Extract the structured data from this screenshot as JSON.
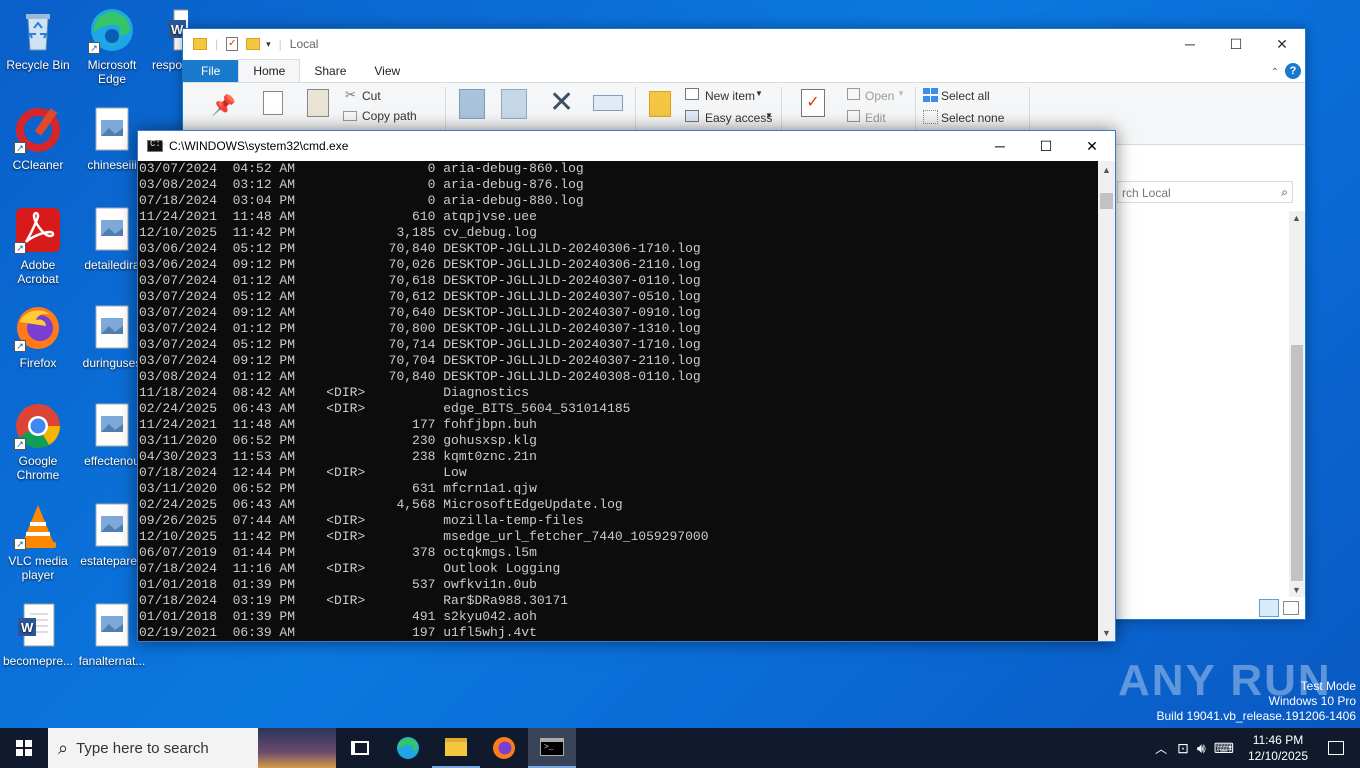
{
  "desktop_icons": [
    {
      "label": "Recycle Bin",
      "icon": "recycle-bin-icon"
    },
    {
      "label": "Microsoft Edge",
      "icon": "edge-icon"
    },
    {
      "label": "respo",
      "icon": "word-doc-icon"
    },
    {
      "label": "CCleaner",
      "icon": "ccleaner-icon"
    },
    {
      "label": "chineseiii",
      "icon": "image-file-icon"
    },
    {
      "label": "Adobe Acrobat",
      "icon": "acrobat-icon"
    },
    {
      "label": "detailedira",
      "icon": "image-file-icon"
    },
    {
      "label": "Firefox",
      "icon": "firefox-icon"
    },
    {
      "label": "duringuses",
      "icon": "image-file-icon"
    },
    {
      "label": "Google Chrome",
      "icon": "chrome-icon"
    },
    {
      "label": "effectenou",
      "icon": "image-file-icon"
    },
    {
      "label": "VLC media player",
      "icon": "vlc-icon"
    },
    {
      "label": "estateparen",
      "icon": "image-file-icon"
    },
    {
      "label": "becomepre...",
      "icon": "word-doc-icon"
    },
    {
      "label": "fanalternat...",
      "icon": "image-file-icon"
    }
  ],
  "explorer": {
    "title": "Local",
    "tabs": [
      "File",
      "Home",
      "Share",
      "View"
    ],
    "ribbon": {
      "cut": "Cut",
      "copy_path": "Copy path",
      "new_item": "New item",
      "easy_access": "Easy access",
      "open": "Open",
      "edit": "Edit",
      "select_all": "Select all",
      "select_none": "Select none"
    },
    "search_placeholder": "rch Local"
  },
  "cmd": {
    "title": "C:\\WINDOWS\\system32\\cmd.exe",
    "lines": [
      "03/07/2024  04:52 AM                 0 aria-debug-860.log",
      "03/08/2024  03:12 AM                 0 aria-debug-876.log",
      "07/18/2024  03:04 PM                 0 aria-debug-880.log",
      "11/24/2021  11:48 AM               610 atqpjvse.uee",
      "12/10/2025  11:42 PM             3,185 cv_debug.log",
      "03/06/2024  05:12 PM            70,840 DESKTOP-JGLLJLD-20240306-1710.log",
      "03/06/2024  09:12 PM            70,026 DESKTOP-JGLLJLD-20240306-2110.log",
      "03/07/2024  01:12 AM            70,618 DESKTOP-JGLLJLD-20240307-0110.log",
      "03/07/2024  05:12 AM            70,612 DESKTOP-JGLLJLD-20240307-0510.log",
      "03/07/2024  09:12 AM            70,640 DESKTOP-JGLLJLD-20240307-0910.log",
      "03/07/2024  01:12 PM            70,800 DESKTOP-JGLLJLD-20240307-1310.log",
      "03/07/2024  05:12 PM            70,714 DESKTOP-JGLLJLD-20240307-1710.log",
      "03/07/2024  09:12 PM            70,704 DESKTOP-JGLLJLD-20240307-2110.log",
      "03/08/2024  01:12 AM            70,840 DESKTOP-JGLLJLD-20240308-0110.log",
      "11/18/2024  08:42 AM    <DIR>          Diagnostics",
      "02/24/2025  06:43 AM    <DIR>          edge_BITS_5604_531014185",
      "11/24/2021  11:48 AM               177 fohfjbpn.buh",
      "03/11/2020  06:52 PM               230 gohusxsp.klg",
      "04/30/2023  11:53 AM               238 kqmt0znc.21n",
      "07/18/2024  12:44 PM    <DIR>          Low",
      "03/11/2020  06:52 PM               631 mfcrn1a1.qjw",
      "02/24/2025  06:43 AM             4,568 MicrosoftEdgeUpdate.log",
      "09/26/2025  07:44 AM    <DIR>          mozilla-temp-files",
      "12/10/2025  11:42 PM    <DIR>          msedge_url_fetcher_7440_1059297000",
      "06/07/2019  01:44 PM               378 octqkmgs.l5m",
      "07/18/2024  11:16 AM    <DIR>          Outlook Logging",
      "01/01/2018  01:39 PM               537 owfkvi1n.0ub",
      "07/18/2024  03:19 PM    <DIR>          Rar$DRa988.30171",
      "01/01/2018  01:39 PM               491 s2kyu042.aoh",
      "02/19/2021  06:39 AM               197 u1fl5whj.4vt"
    ]
  },
  "watermark": {
    "brand": "ANY RUN",
    "line1": "Test Mode",
    "line2": "Windows 10 Pro",
    "line3": "Build 19041.vb_release.191206-1406"
  },
  "taskbar": {
    "search_placeholder": "Type here to search",
    "time": "11:46 PM",
    "date": "12/10/2025"
  }
}
